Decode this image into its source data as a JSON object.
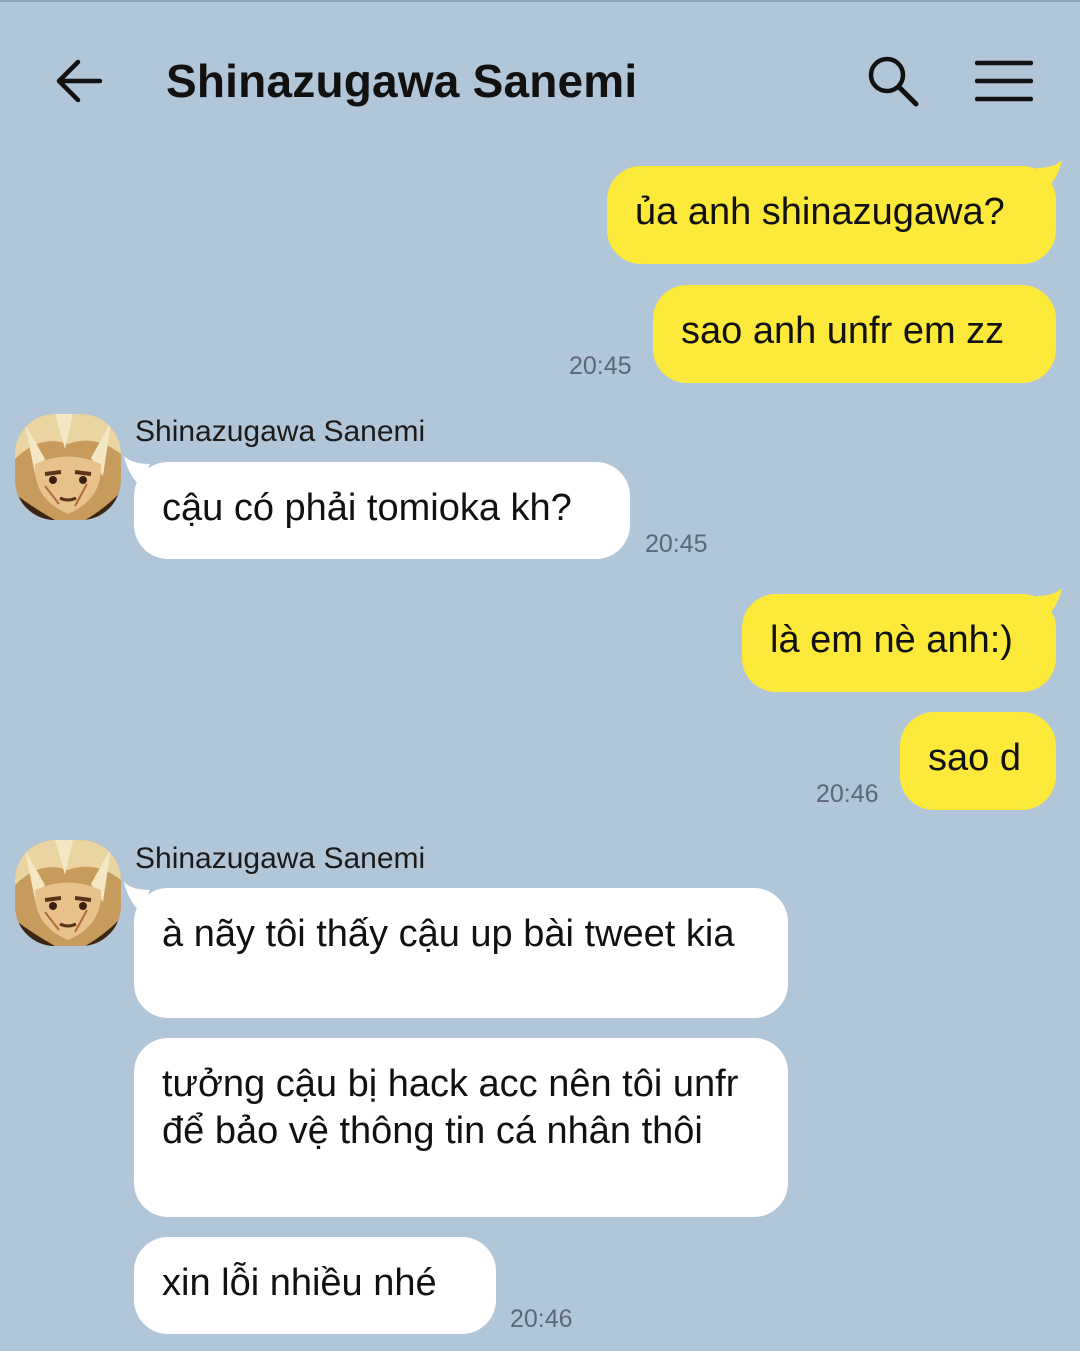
{
  "header": {
    "title": "Shinazugawa Sanemi",
    "back_icon": "arrow-left-icon",
    "search_icon": "search-icon",
    "menu_icon": "hamburger-menu-icon"
  },
  "messages": [
    {
      "text": "ủa anh shinazugawa?",
      "side": "outgoing"
    },
    {
      "text": "sao anh unfr em zz",
      "side": "outgoing",
      "time": "20:45"
    },
    {
      "sender": "Shinazugawa Sanemi",
      "text": "cậu có phải tomioka kh?",
      "side": "incoming",
      "time": "20:45"
    },
    {
      "text": "là em nè anh:)",
      "side": "outgoing"
    },
    {
      "text": "sao d",
      "side": "outgoing",
      "time": "20:46"
    },
    {
      "sender": "Shinazugawa Sanemi",
      "text": "à nãy tôi thấy cậu up bài tweet kia",
      "side": "incoming"
    },
    {
      "text": "tưởng cậu bị hack acc nên tôi unfr để bảo vệ thông tin cá nhân thôi",
      "side": "incoming"
    },
    {
      "text": "xin lỗi nhiều nhé",
      "side": "incoming",
      "time": "20:46"
    }
  ],
  "colors": {
    "background": "#b2c6d9",
    "outgoing_bubble": "#fde93a",
    "incoming_bubble": "#ffffff",
    "timestamp": "#5d6874"
  }
}
